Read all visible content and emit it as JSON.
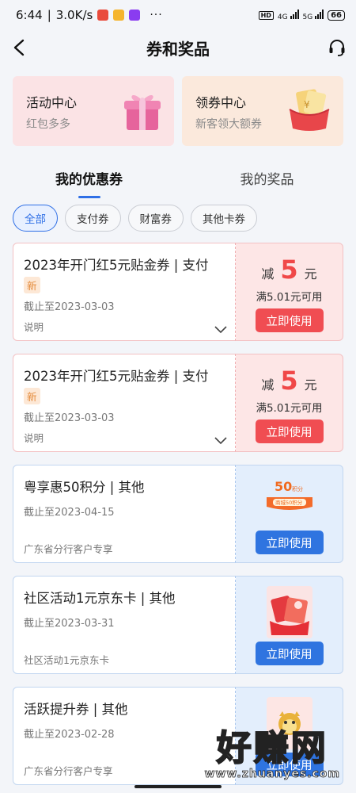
{
  "status_bar": {
    "time": "6:44",
    "net_speed": "3.0K/s",
    "more": "···",
    "hd": "HD",
    "sig1": "4G",
    "sig2": "5G",
    "battery": "66"
  },
  "header": {
    "title": "券和奖品"
  },
  "promos": [
    {
      "title": "活动中心",
      "subtitle": "红包多多",
      "icon": "gift-box-icon"
    },
    {
      "title": "领券中心",
      "subtitle": "新客领大额券",
      "icon": "red-envelope-icon",
      "envelope_mark": "¥"
    }
  ],
  "tabs": [
    {
      "label": "我的优惠券",
      "active": true
    },
    {
      "label": "我的奖品",
      "active": false
    }
  ],
  "chips": [
    {
      "label": "全部",
      "active": true
    },
    {
      "label": "支付券"
    },
    {
      "label": "财富券"
    },
    {
      "label": "其他卡券"
    }
  ],
  "coupons": [
    {
      "title": "2023年开门红5元贴金券 | 支付",
      "tag": "新",
      "expiry": "截止至2023-03-03",
      "desc": "说明",
      "reduce_prefix": "减",
      "amount": "5",
      "unit": "元",
      "condition": "满5.01元可用",
      "action": "立即使用"
    },
    {
      "title": "2023年开门红5元贴金券 | 支付",
      "tag": "新",
      "expiry": "截止至2023-03-03",
      "desc": "说明",
      "reduce_prefix": "减",
      "amount": "5",
      "unit": "元",
      "condition": "满5.01元可用",
      "action": "立即使用"
    },
    {
      "title": "粤享惠50积分 | 其他",
      "expiry": "截止至2023-04-15",
      "desc": "广东省分行客户专享",
      "thumb_amount": "50",
      "thumb_unit": "积分",
      "thumb_label": "商城50积分",
      "action": "立即使用"
    },
    {
      "title": "社区活动1元京东卡 | 其他",
      "expiry": "截止至2023-03-31",
      "desc": "社区活动1元京东卡",
      "action": "立即使用"
    },
    {
      "title": "活跃提升券 | 其他",
      "expiry": "截止至2023-02-28",
      "desc": "广东省分行客户专享",
      "action": "立即使用"
    }
  ],
  "watermark": {
    "text": "好赚网",
    "url": "www.zhuanyes.com"
  },
  "colors": {
    "accent": "#2f6fe6",
    "red": "#f04848"
  }
}
